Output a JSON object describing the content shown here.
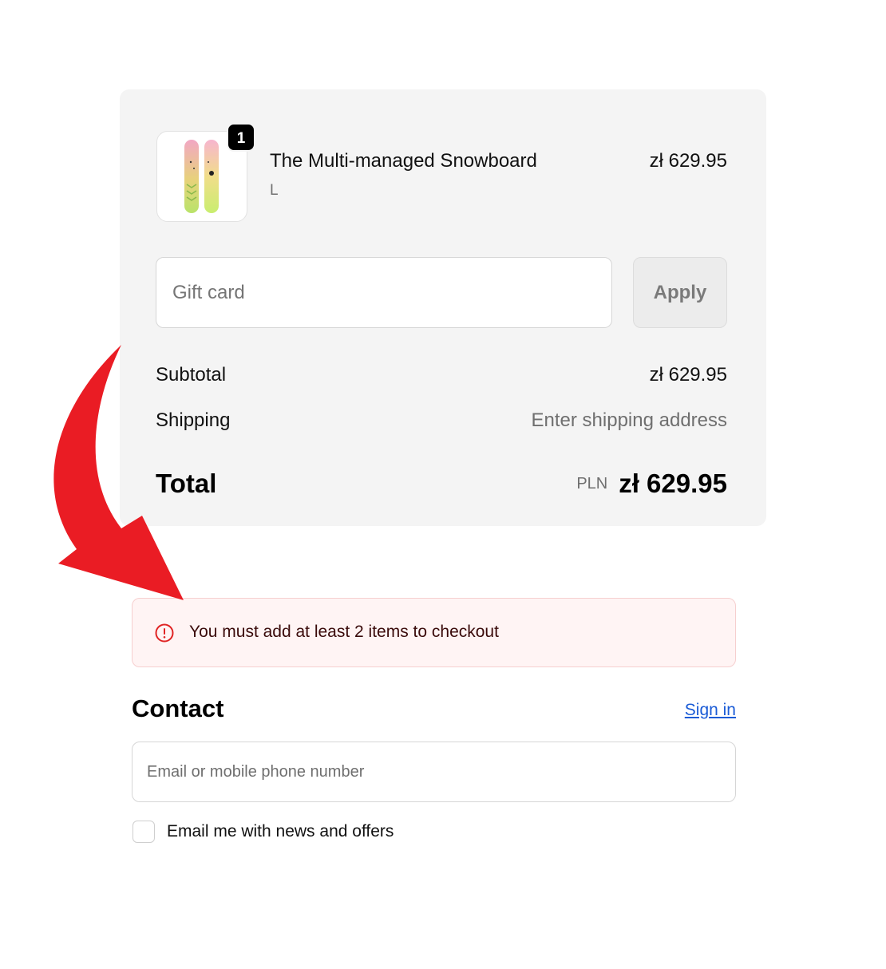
{
  "order_summary": {
    "item": {
      "quantity": "1",
      "name": "The Multi-managed Snowboard",
      "variant": "L",
      "price": "zł 629.95",
      "image": "snowboard-product-image"
    },
    "gift_card": {
      "placeholder": "Gift card",
      "value": "",
      "apply_label": "Apply"
    },
    "subtotal": {
      "label": "Subtotal",
      "value": "zł 629.95"
    },
    "shipping": {
      "label": "Shipping",
      "value": "Enter shipping address"
    },
    "total": {
      "label": "Total",
      "currency": "PLN",
      "value": "zł 629.95"
    }
  },
  "alert": {
    "icon": "error-circle-icon",
    "message": "You must add at least 2 items to checkout",
    "color": "#e02424"
  },
  "contact": {
    "title": "Contact",
    "sign_in_label": "Sign in",
    "email_placeholder": "Email or mobile phone number",
    "email_value": "",
    "newsletter_label": "Email me with news and offers",
    "newsletter_checked": false
  },
  "annotation": {
    "icon": "red-curved-arrow",
    "color": "#ea1c24"
  }
}
